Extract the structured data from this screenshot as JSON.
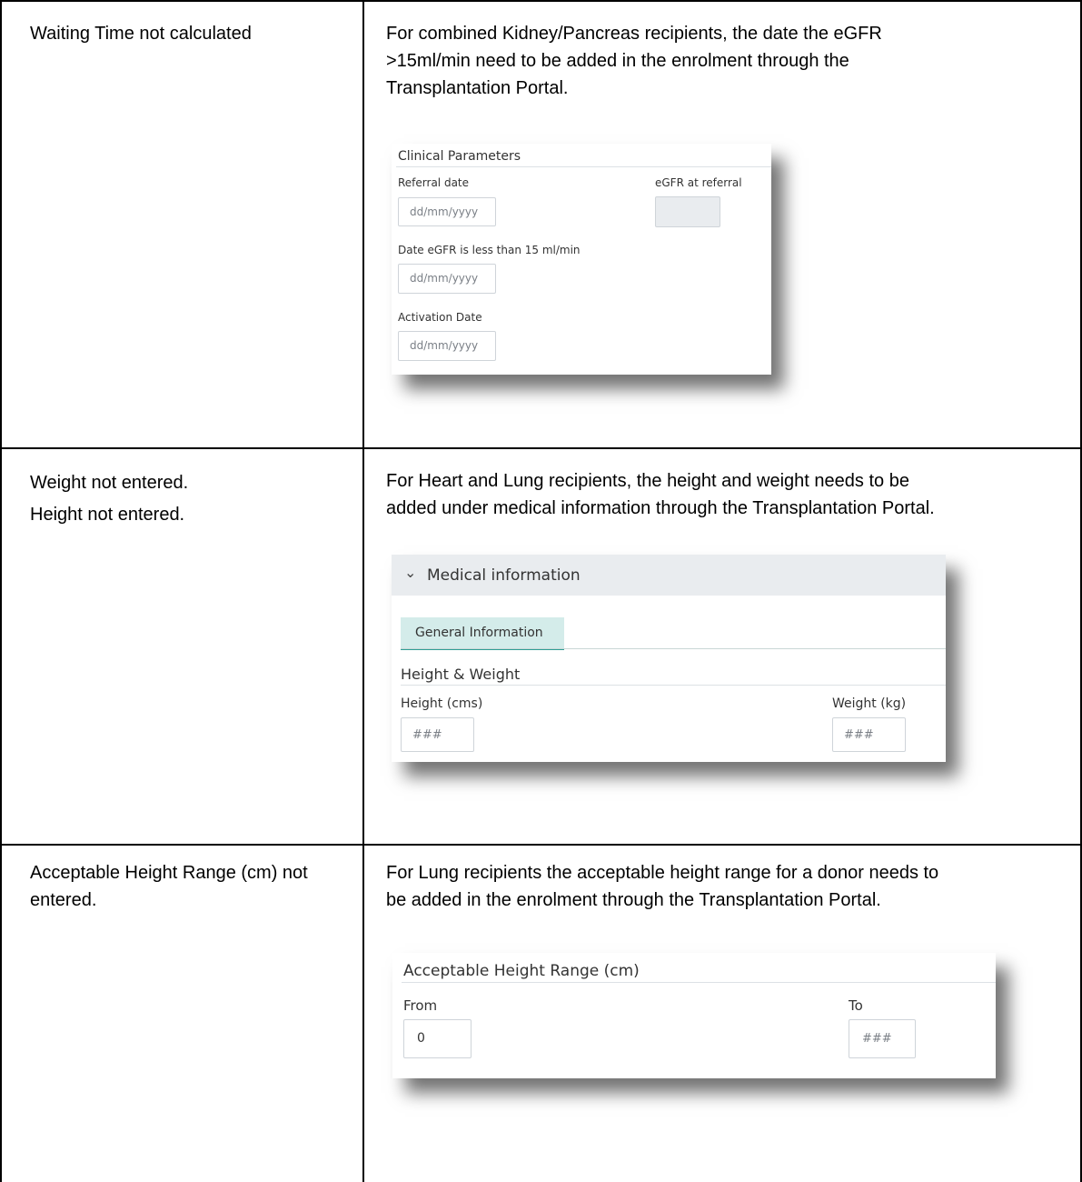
{
  "rows": [
    {
      "issue_lines": [
        "Waiting Time not calculated"
      ],
      "guidance_lines": [
        "For combined Kidney/Pancreas recipients, the date the eGFR",
        ">15ml/min need to be added in the enrolment through the",
        "Transplantation Portal."
      ],
      "panel": {
        "title": "Clinical Parameters",
        "referral_label": "Referral date",
        "referral_placeholder": "dd/mm/yyyy",
        "egfr_label": "eGFR at referral",
        "egfr_value": "",
        "egfr_date_label": "Date eGFR is less than 15 ml/min",
        "egfr_date_placeholder": "dd/mm/yyyy",
        "activation_label": "Activation Date",
        "activation_placeholder": "dd/mm/yyyy"
      }
    },
    {
      "issue_lines": [
        "Weight not entered.",
        "Height not entered."
      ],
      "guidance_lines": [
        "For Heart and Lung recipients, the height and weight needs to be",
        "added under medical information through the Transplantation Portal."
      ],
      "panel": {
        "section_title": "Medical information",
        "tab_label": "General Information",
        "group_title": "Height & Weight",
        "height_label": "Height (cms)",
        "height_placeholder": "###",
        "weight_label": "Weight (kg)",
        "weight_placeholder": "###"
      }
    },
    {
      "issue_lines": [
        "Acceptable Height Range (cm) not",
        "entered."
      ],
      "guidance_lines": [
        "For Lung recipients the acceptable height range for a donor needs to",
        "be added in the enrolment through the Transplantation Portal."
      ],
      "panel": {
        "title": "Acceptable Height Range (cm)",
        "from_label": "From",
        "from_value": "0",
        "to_label": "To",
        "to_placeholder": "###"
      }
    }
  ],
  "colors": {
    "tab_bg": "#d4ecea",
    "tab_underline": "#2f9e95",
    "header_bg": "#e9ecef",
    "disabled_field": "#e9ecef"
  }
}
